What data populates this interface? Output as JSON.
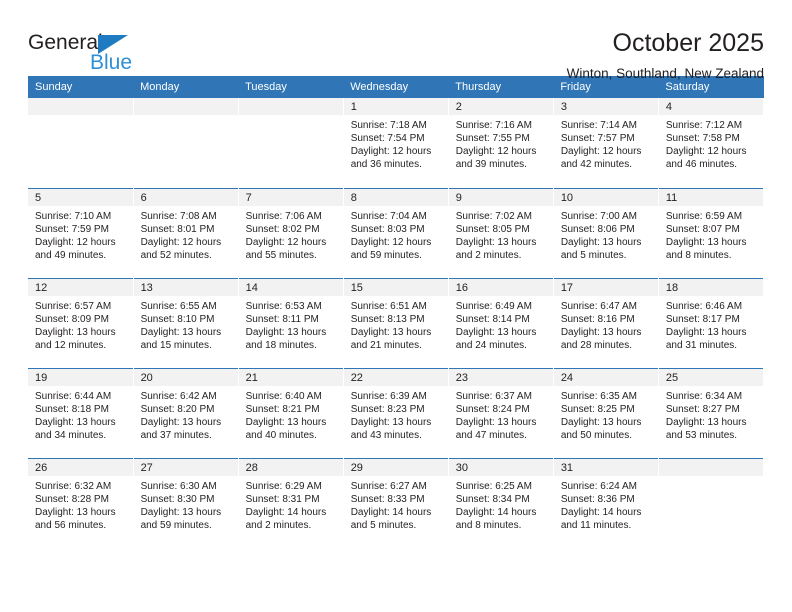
{
  "brand": {
    "name_top": "General",
    "name_bottom": "Blue",
    "accent_color": "#2f8fd6",
    "triangle_color": "#1f7bc1"
  },
  "header": {
    "title": "October 2025",
    "subtitle": "Winton, Southland, New Zealand",
    "header_bg": "#3075b5",
    "header_text_color": "#ffffff",
    "daynum_band_bg": "#f2f2f2"
  },
  "weekday_headers": [
    "Sunday",
    "Monday",
    "Tuesday",
    "Wednesday",
    "Thursday",
    "Friday",
    "Saturday"
  ],
  "weeks": [
    [
      {
        "day": "",
        "sunrise": "",
        "sunset": "",
        "daylight1": "",
        "daylight2": "",
        "empty": true
      },
      {
        "day": "",
        "sunrise": "",
        "sunset": "",
        "daylight1": "",
        "daylight2": "",
        "empty": true
      },
      {
        "day": "",
        "sunrise": "",
        "sunset": "",
        "daylight1": "",
        "daylight2": "",
        "empty": true
      },
      {
        "day": "1",
        "sunrise": "Sunrise: 7:18 AM",
        "sunset": "Sunset: 7:54 PM",
        "daylight1": "Daylight: 12 hours",
        "daylight2": "and 36 minutes."
      },
      {
        "day": "2",
        "sunrise": "Sunrise: 7:16 AM",
        "sunset": "Sunset: 7:55 PM",
        "daylight1": "Daylight: 12 hours",
        "daylight2": "and 39 minutes."
      },
      {
        "day": "3",
        "sunrise": "Sunrise: 7:14 AM",
        "sunset": "Sunset: 7:57 PM",
        "daylight1": "Daylight: 12 hours",
        "daylight2": "and 42 minutes."
      },
      {
        "day": "4",
        "sunrise": "Sunrise: 7:12 AM",
        "sunset": "Sunset: 7:58 PM",
        "daylight1": "Daylight: 12 hours",
        "daylight2": "and 46 minutes."
      }
    ],
    [
      {
        "day": "5",
        "sunrise": "Sunrise: 7:10 AM",
        "sunset": "Sunset: 7:59 PM",
        "daylight1": "Daylight: 12 hours",
        "daylight2": "and 49 minutes."
      },
      {
        "day": "6",
        "sunrise": "Sunrise: 7:08 AM",
        "sunset": "Sunset: 8:01 PM",
        "daylight1": "Daylight: 12 hours",
        "daylight2": "and 52 minutes."
      },
      {
        "day": "7",
        "sunrise": "Sunrise: 7:06 AM",
        "sunset": "Sunset: 8:02 PM",
        "daylight1": "Daylight: 12 hours",
        "daylight2": "and 55 minutes."
      },
      {
        "day": "8",
        "sunrise": "Sunrise: 7:04 AM",
        "sunset": "Sunset: 8:03 PM",
        "daylight1": "Daylight: 12 hours",
        "daylight2": "and 59 minutes."
      },
      {
        "day": "9",
        "sunrise": "Sunrise: 7:02 AM",
        "sunset": "Sunset: 8:05 PM",
        "daylight1": "Daylight: 13 hours",
        "daylight2": "and 2 minutes."
      },
      {
        "day": "10",
        "sunrise": "Sunrise: 7:00 AM",
        "sunset": "Sunset: 8:06 PM",
        "daylight1": "Daylight: 13 hours",
        "daylight2": "and 5 minutes."
      },
      {
        "day": "11",
        "sunrise": "Sunrise: 6:59 AM",
        "sunset": "Sunset: 8:07 PM",
        "daylight1": "Daylight: 13 hours",
        "daylight2": "and 8 minutes."
      }
    ],
    [
      {
        "day": "12",
        "sunrise": "Sunrise: 6:57 AM",
        "sunset": "Sunset: 8:09 PM",
        "daylight1": "Daylight: 13 hours",
        "daylight2": "and 12 minutes."
      },
      {
        "day": "13",
        "sunrise": "Sunrise: 6:55 AM",
        "sunset": "Sunset: 8:10 PM",
        "daylight1": "Daylight: 13 hours",
        "daylight2": "and 15 minutes."
      },
      {
        "day": "14",
        "sunrise": "Sunrise: 6:53 AM",
        "sunset": "Sunset: 8:11 PM",
        "daylight1": "Daylight: 13 hours",
        "daylight2": "and 18 minutes."
      },
      {
        "day": "15",
        "sunrise": "Sunrise: 6:51 AM",
        "sunset": "Sunset: 8:13 PM",
        "daylight1": "Daylight: 13 hours",
        "daylight2": "and 21 minutes."
      },
      {
        "day": "16",
        "sunrise": "Sunrise: 6:49 AM",
        "sunset": "Sunset: 8:14 PM",
        "daylight1": "Daylight: 13 hours",
        "daylight2": "and 24 minutes."
      },
      {
        "day": "17",
        "sunrise": "Sunrise: 6:47 AM",
        "sunset": "Sunset: 8:16 PM",
        "daylight1": "Daylight: 13 hours",
        "daylight2": "and 28 minutes."
      },
      {
        "day": "18",
        "sunrise": "Sunrise: 6:46 AM",
        "sunset": "Sunset: 8:17 PM",
        "daylight1": "Daylight: 13 hours",
        "daylight2": "and 31 minutes."
      }
    ],
    [
      {
        "day": "19",
        "sunrise": "Sunrise: 6:44 AM",
        "sunset": "Sunset: 8:18 PM",
        "daylight1": "Daylight: 13 hours",
        "daylight2": "and 34 minutes."
      },
      {
        "day": "20",
        "sunrise": "Sunrise: 6:42 AM",
        "sunset": "Sunset: 8:20 PM",
        "daylight1": "Daylight: 13 hours",
        "daylight2": "and 37 minutes."
      },
      {
        "day": "21",
        "sunrise": "Sunrise: 6:40 AM",
        "sunset": "Sunset: 8:21 PM",
        "daylight1": "Daylight: 13 hours",
        "daylight2": "and 40 minutes."
      },
      {
        "day": "22",
        "sunrise": "Sunrise: 6:39 AM",
        "sunset": "Sunset: 8:23 PM",
        "daylight1": "Daylight: 13 hours",
        "daylight2": "and 43 minutes."
      },
      {
        "day": "23",
        "sunrise": "Sunrise: 6:37 AM",
        "sunset": "Sunset: 8:24 PM",
        "daylight1": "Daylight: 13 hours",
        "daylight2": "and 47 minutes."
      },
      {
        "day": "24",
        "sunrise": "Sunrise: 6:35 AM",
        "sunset": "Sunset: 8:25 PM",
        "daylight1": "Daylight: 13 hours",
        "daylight2": "and 50 minutes."
      },
      {
        "day": "25",
        "sunrise": "Sunrise: 6:34 AM",
        "sunset": "Sunset: 8:27 PM",
        "daylight1": "Daylight: 13 hours",
        "daylight2": "and 53 minutes."
      }
    ],
    [
      {
        "day": "26",
        "sunrise": "Sunrise: 6:32 AM",
        "sunset": "Sunset: 8:28 PM",
        "daylight1": "Daylight: 13 hours",
        "daylight2": "and 56 minutes."
      },
      {
        "day": "27",
        "sunrise": "Sunrise: 6:30 AM",
        "sunset": "Sunset: 8:30 PM",
        "daylight1": "Daylight: 13 hours",
        "daylight2": "and 59 minutes."
      },
      {
        "day": "28",
        "sunrise": "Sunrise: 6:29 AM",
        "sunset": "Sunset: 8:31 PM",
        "daylight1": "Daylight: 14 hours",
        "daylight2": "and 2 minutes."
      },
      {
        "day": "29",
        "sunrise": "Sunrise: 6:27 AM",
        "sunset": "Sunset: 8:33 PM",
        "daylight1": "Daylight: 14 hours",
        "daylight2": "and 5 minutes."
      },
      {
        "day": "30",
        "sunrise": "Sunrise: 6:25 AM",
        "sunset": "Sunset: 8:34 PM",
        "daylight1": "Daylight: 14 hours",
        "daylight2": "and 8 minutes."
      },
      {
        "day": "31",
        "sunrise": "Sunrise: 6:24 AM",
        "sunset": "Sunset: 8:36 PM",
        "daylight1": "Daylight: 14 hours",
        "daylight2": "and 11 minutes."
      },
      {
        "day": "",
        "sunrise": "",
        "sunset": "",
        "daylight1": "",
        "daylight2": "",
        "empty": true
      }
    ]
  ]
}
